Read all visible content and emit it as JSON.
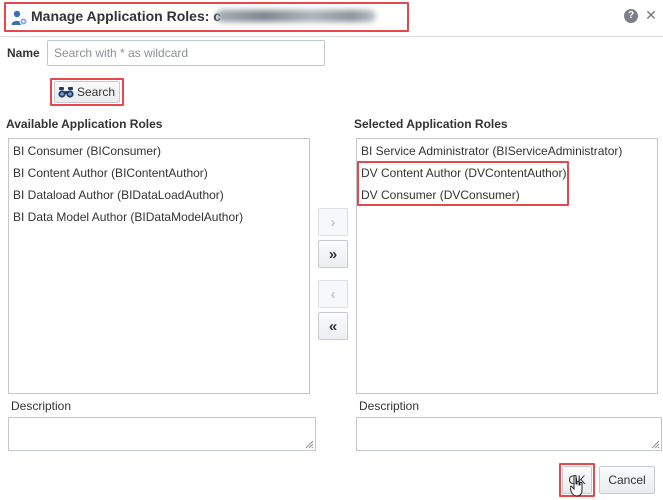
{
  "dialog": {
    "title": "Manage Application Roles: c",
    "help_icon": "help-icon",
    "close_icon": "close-icon"
  },
  "search": {
    "label": "Name",
    "placeholder": "Search with * as wildcard",
    "value": "",
    "button_label": "Search",
    "button_icon": "binoculars-icon"
  },
  "available": {
    "heading": "Available Application Roles",
    "items": [
      "BI Consumer (BIConsumer)",
      "BI Content Author (BIContentAuthor)",
      "BI Dataload Author (BIDataLoadAuthor)",
      "BI Data Model Author (BIDataModelAuthor)"
    ],
    "description_label": "Description"
  },
  "selected": {
    "heading": "Selected Application Roles",
    "items": [
      "BI Service Administrator (BIServiceAdministrator)",
      "DV Content Author (DVContentAuthor)",
      "DV Consumer (DVConsumer)"
    ],
    "description_label": "Description"
  },
  "shuttle": {
    "move": "›",
    "move_all": "»",
    "remove": "‹",
    "remove_all": "«"
  },
  "footer": {
    "ok_label": "OK",
    "cancel_label": "Cancel"
  },
  "colors": {
    "highlight": "#e8474c",
    "border": "#c3c8cd"
  }
}
